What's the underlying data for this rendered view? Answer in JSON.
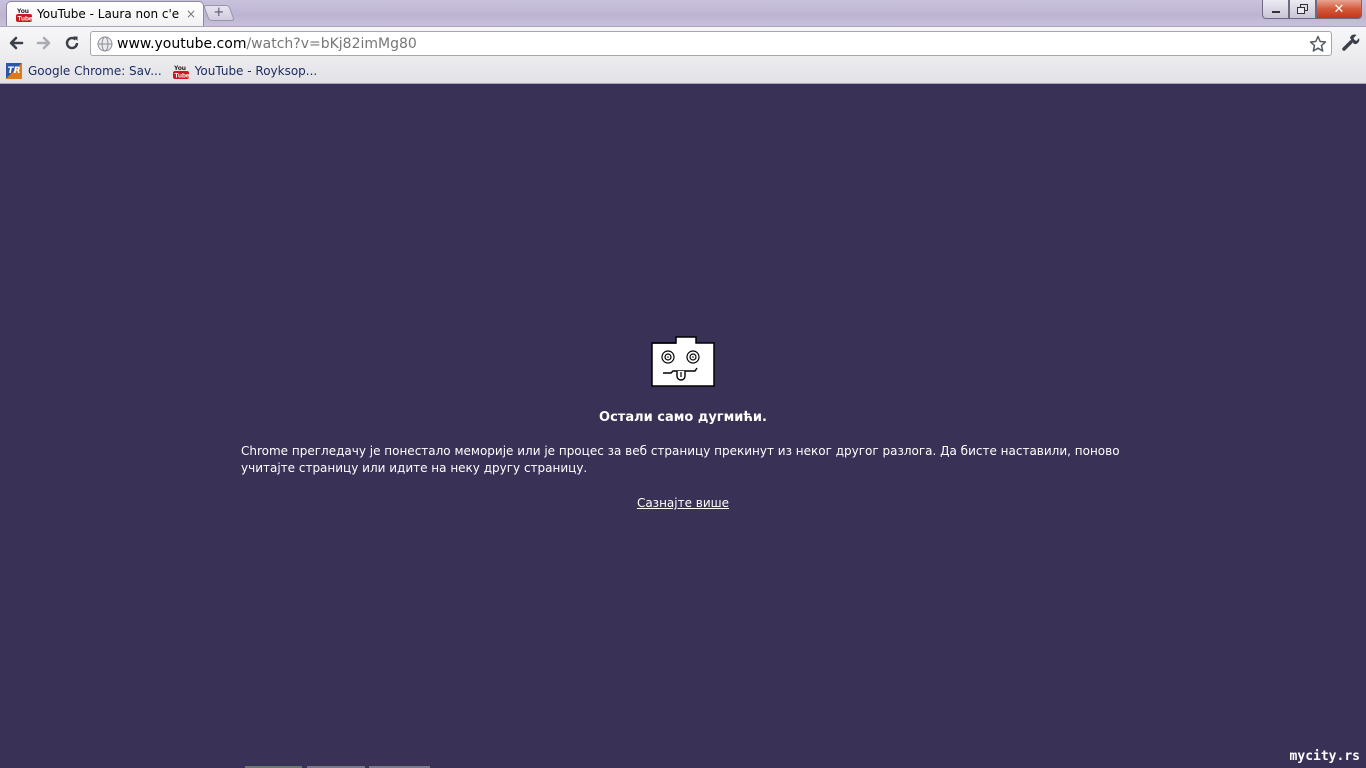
{
  "window": {
    "tab": {
      "title": "YouTube - Laura non c'e",
      "close": "×",
      "favicon_label": "You Tube"
    },
    "new_tab": "+",
    "controls": {
      "minimize": "–",
      "maximize": "□",
      "close": "✕"
    }
  },
  "toolbar": {
    "back_icon": "back-arrow-icon",
    "forward_icon": "forward-arrow-icon",
    "reload_icon": "reload-icon",
    "url_host": "www.youtube.com",
    "url_path": "/watch?v=bKj82imMg80",
    "bookmark_star_icon": "star-icon",
    "menu_icon": "wrench-icon"
  },
  "bookmarks": [
    {
      "label": "Google Chrome: Sav...",
      "icon": "tr-favicon"
    },
    {
      "label": "YouTube - Royksop...",
      "icon": "youtube-favicon"
    }
  ],
  "sad_tab": {
    "title": "Остали само дугмићи.",
    "message": "Chrome прегледачу је понестало меморије или је процес за веб страницу прекинут из неког другог разлога. Да бисте наставили, поново учитајте страницу или идите на неку другу страницу.",
    "learn_more": "Сазнајте више",
    "background_color": "#3a3156"
  },
  "watermark": "mycity.rs"
}
